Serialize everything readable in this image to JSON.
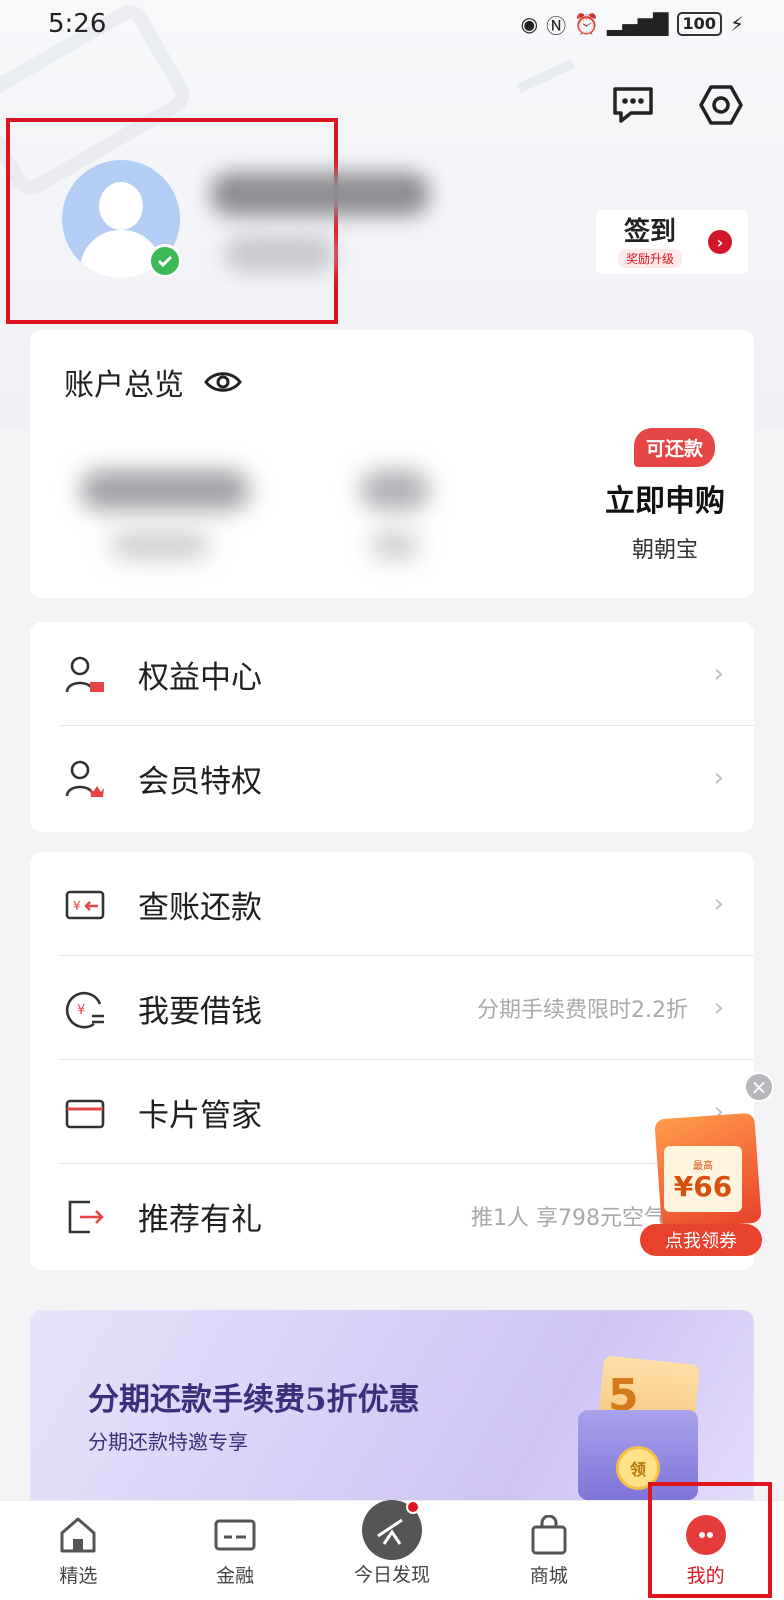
{
  "status_bar": {
    "time": "5:26",
    "battery": "100"
  },
  "profile": {},
  "signin": {
    "title": "签到",
    "subtitle": "奖励升级"
  },
  "account": {
    "title": "账户总览",
    "repay_badge": "可还款",
    "buy_title": "立即申购",
    "buy_sub": "朝朝宝"
  },
  "menu_group1": [
    {
      "label": "权益中心",
      "icon": "benefit-icon"
    },
    {
      "label": "会员特权",
      "icon": "member-icon"
    }
  ],
  "menu_group2": [
    {
      "label": "查账还款",
      "hint": "",
      "icon": "bill-icon"
    },
    {
      "label": "我要借钱",
      "hint": "分期手续费限时2.2折",
      "icon": "loan-icon"
    },
    {
      "label": "卡片管家",
      "hint": "",
      "icon": "card-icon"
    },
    {
      "label": "推荐有礼",
      "hint": "推1人 享798元空气炸",
      "icon": "refer-icon"
    }
  ],
  "float_coupon": {
    "small": "最高",
    "amount": "¥66",
    "button": "点我领券"
  },
  "banner": {
    "title": "分期还款手续费5折优惠",
    "subtitle": "分期还款特邀专享",
    "number": "5",
    "coin": "领"
  },
  "tabs": [
    {
      "label": "精选",
      "icon": "home-icon"
    },
    {
      "label": "金融",
      "icon": "finance-card-icon"
    },
    {
      "label": "今日发现",
      "icon": "telescope-icon"
    },
    {
      "label": "商城",
      "icon": "shopping-bag-icon"
    },
    {
      "label": "我的",
      "icon": "profile-icon",
      "active": true
    }
  ],
  "colors": {
    "accent": "#e0141e",
    "badge": "#e64545",
    "banner_text": "#3a2f7a"
  }
}
